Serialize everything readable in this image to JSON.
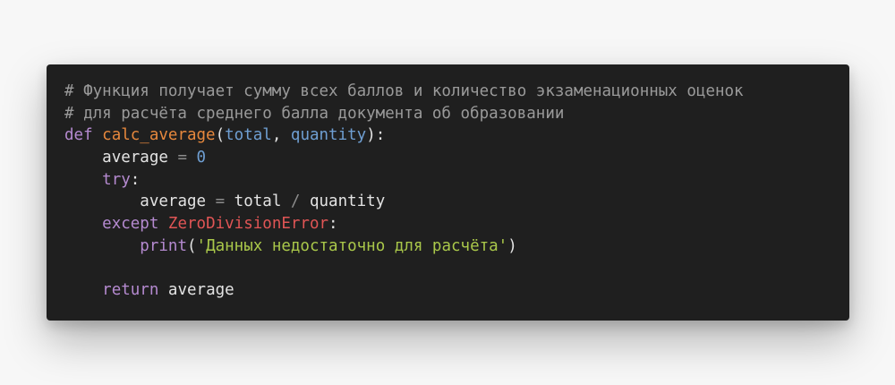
{
  "code": {
    "line1": {
      "comment": "# Функция получает сумму всех баллов и количество экзаменационных оценок"
    },
    "line2": {
      "comment": "# для расчёта среднего балла документа об образовании"
    },
    "line3": {
      "kw_def": "def",
      "func_name": "calc_average",
      "paren_open": "(",
      "param1": "total",
      "comma": ", ",
      "param2": "quantity",
      "paren_close_colon": "):"
    },
    "line4": {
      "indent": "    ",
      "var": "average",
      "eq": " = ",
      "num": "0"
    },
    "line5": {
      "indent": "    ",
      "kw_try": "try",
      "colon": ":"
    },
    "line6": {
      "indent": "        ",
      "var": "average",
      "eq": " = ",
      "lhs": "total",
      "div": " / ",
      "rhs": "quantity"
    },
    "line7": {
      "indent": "    ",
      "kw_except": "except",
      "space": " ",
      "exception": "ZeroDivisionError",
      "colon": ":"
    },
    "line8": {
      "indent": "        ",
      "builtin": "print",
      "paren_open": "(",
      "string": "'Данных недостаточно для расчёта'",
      "paren_close": ")"
    },
    "line9": {
      "blank": ""
    },
    "line10": {
      "indent": "    ",
      "kw_return": "return",
      "space": " ",
      "var": "average"
    }
  },
  "colors": {
    "background": "#f7f7f7",
    "card": "#1f1f1f",
    "comment": "#9a9a9a",
    "keyword": "#b58ad0",
    "function": "#e7883d",
    "parameter": "#6f9fd3",
    "exception": "#e05555",
    "string": "#aac84a",
    "text": "#e3e3e3"
  }
}
